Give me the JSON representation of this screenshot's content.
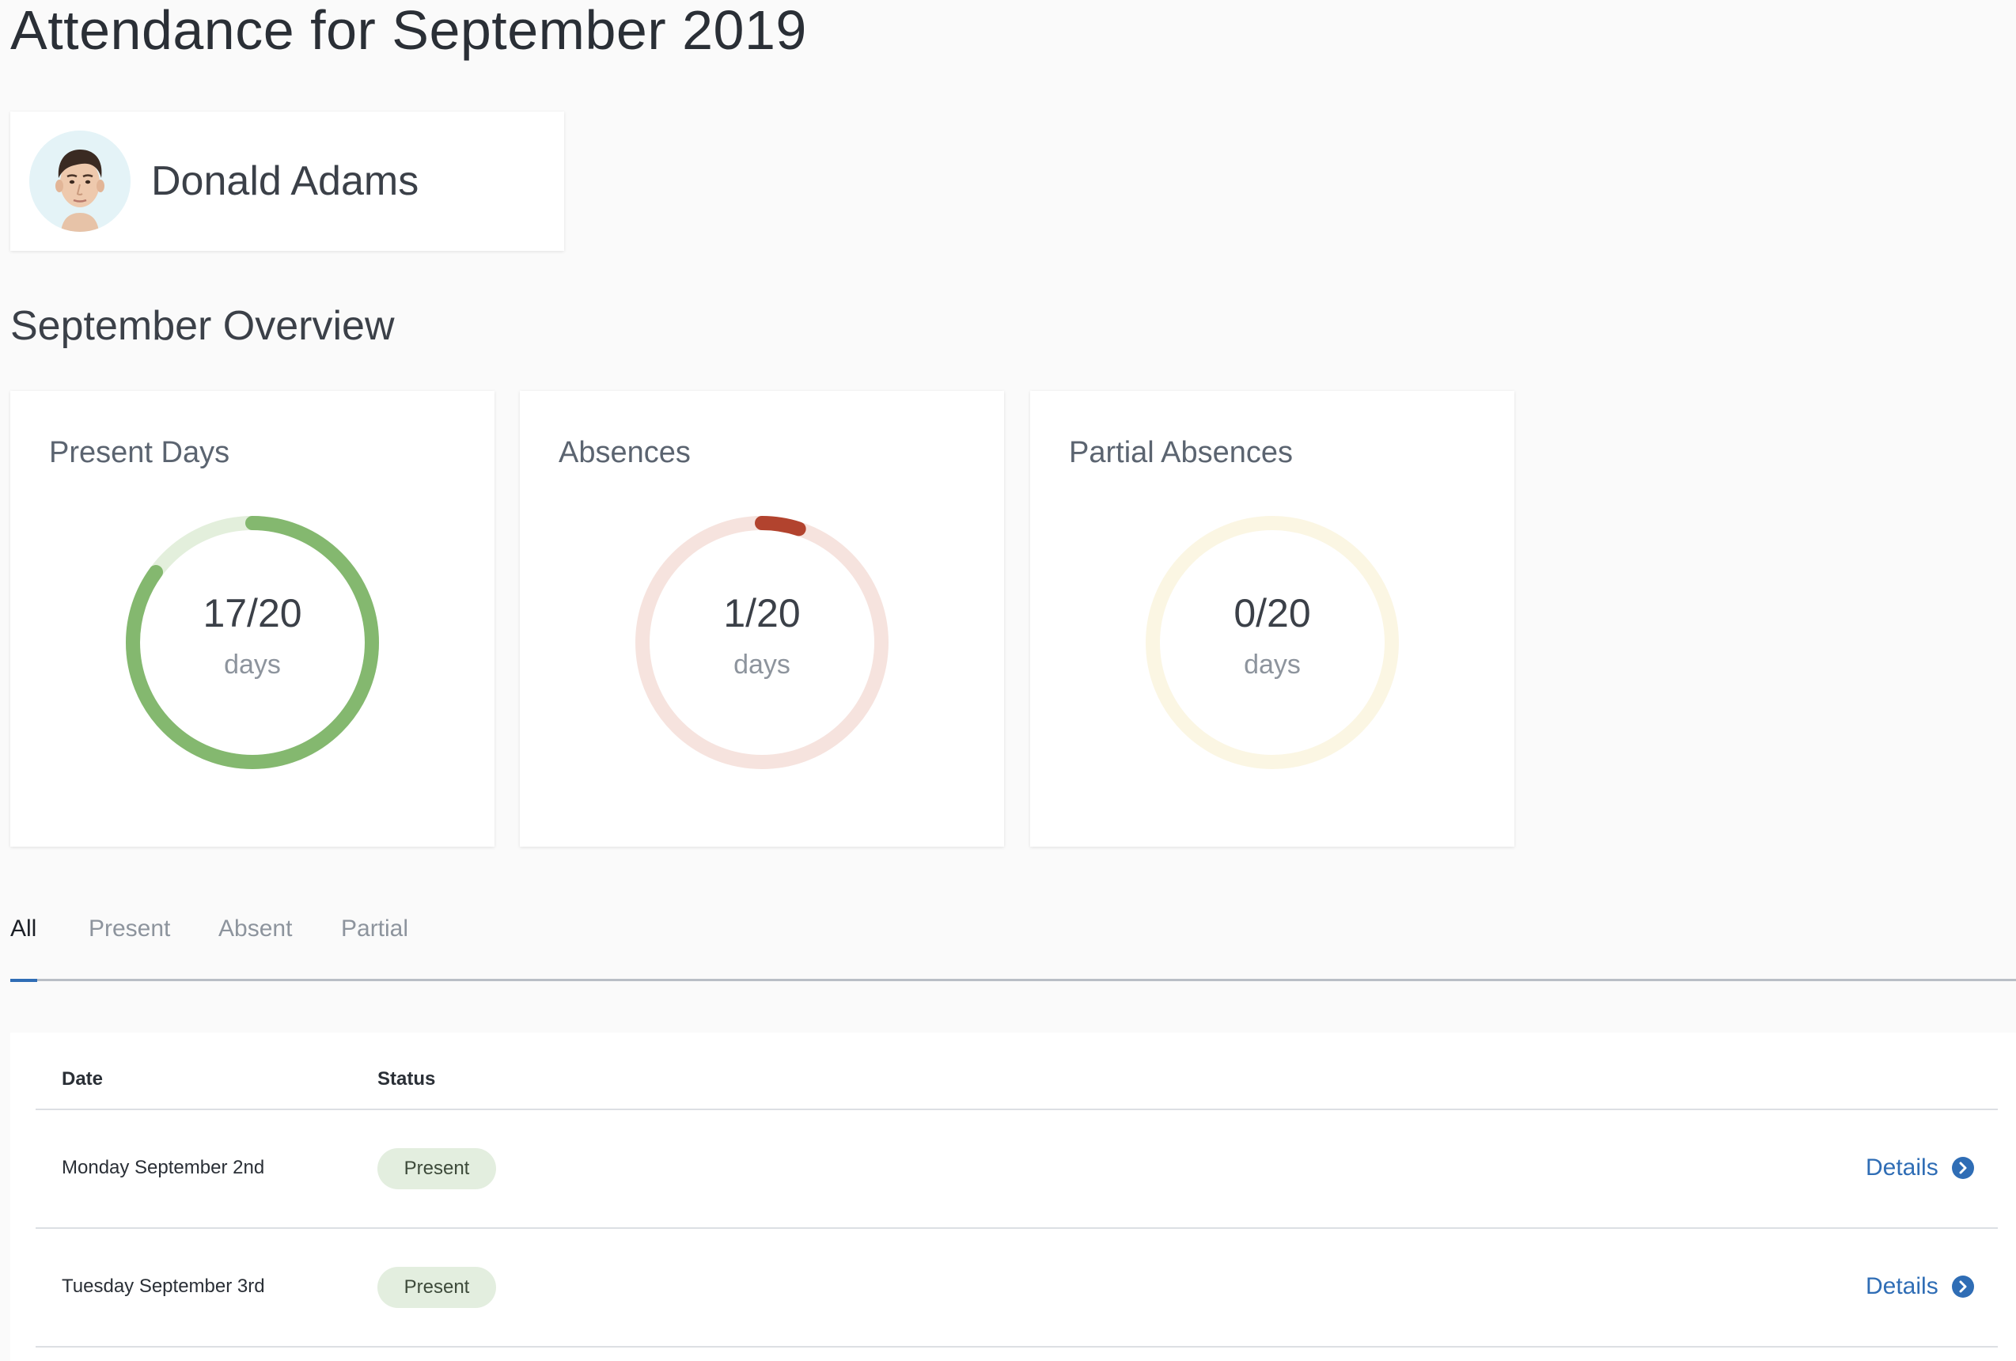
{
  "page": {
    "title": "Attendance for September 2019"
  },
  "student": {
    "name": "Donald Adams"
  },
  "overview": {
    "title": "September Overview",
    "cards": [
      {
        "title": "Present Days",
        "value": "17/20",
        "unit": "days",
        "count": 17,
        "total": 20,
        "color": "#84b86f",
        "track_color": "#e3efdc"
      },
      {
        "title": "Absences",
        "value": "1/20",
        "unit": "days",
        "count": 1,
        "total": 20,
        "color": "#b2432e",
        "track_color": "#f6e3de"
      },
      {
        "title": "Partial Absences",
        "value": "0/20",
        "unit": "days",
        "count": 0,
        "total": 20,
        "color": "#e7c45b",
        "track_color": "#fbf6e3"
      }
    ]
  },
  "tabs": [
    {
      "label": "All",
      "active": true
    },
    {
      "label": "Present",
      "active": false
    },
    {
      "label": "Absent",
      "active": false
    },
    {
      "label": "Partial",
      "active": false
    }
  ],
  "table": {
    "headers": {
      "date": "Date",
      "status": "Status"
    },
    "rows": [
      {
        "date": "Monday September 2nd",
        "status": "Present",
        "action": "Details"
      },
      {
        "date": "Tuesday September 3rd",
        "status": "Present",
        "action": "Details"
      }
    ]
  },
  "colors": {
    "accent": "#2f6db5",
    "present_badge": "#e3eedf"
  },
  "icons": {
    "details": "chevron-right-circle-icon",
    "avatar": "avatar-photo"
  }
}
